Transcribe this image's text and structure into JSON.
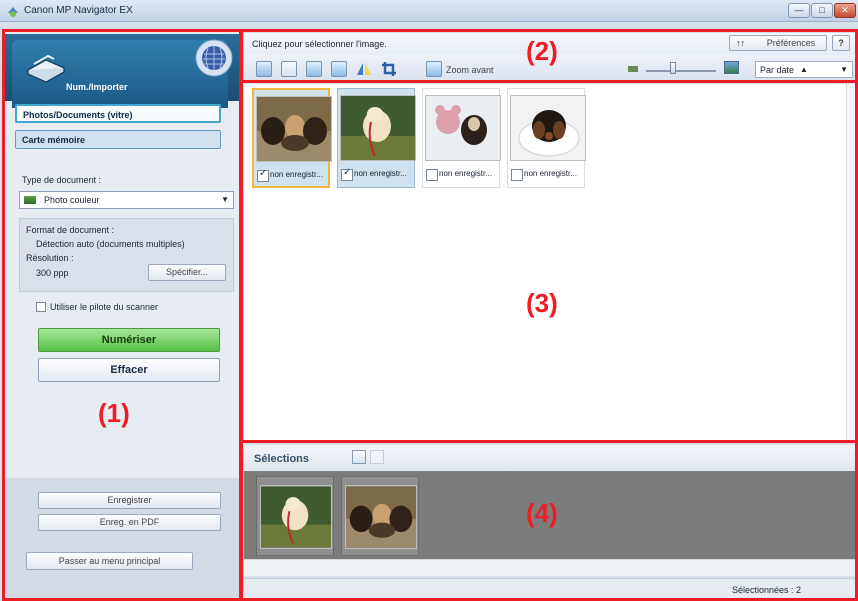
{
  "window": {
    "title": "Canon MP Navigator EX",
    "controls": {
      "minimize": "—",
      "maximize": "□",
      "close": "✕"
    }
  },
  "sidebar": {
    "hero_label": "Num./Importer",
    "modes": [
      "Photos/Documents (vitre)",
      "Carte mémoire"
    ],
    "doc_type_label": "Type de document :",
    "doc_type_value": "Photo couleur",
    "format_label": "Format de document :",
    "format_value": "Détection auto (documents multiples)",
    "resolution_label": "Résolution :",
    "resolution_value": "300 ppp",
    "specify_button": "Spécifier...",
    "driver_checkbox_label": "Utiliser le pilote du scanner",
    "scan_button": "Numériser",
    "clear_button": "Effacer",
    "save_button": "Enregistrer",
    "save_pdf_button": "Enreg. en PDF",
    "main_menu_button": "Passer au menu principal"
  },
  "toolbar": {
    "hint": "Cliquez pour sélectionner l'image.",
    "preferences_icon": "↑↑",
    "preferences": "Préférences",
    "help": "?",
    "zoom_in": "Zoom avant",
    "sort": "Par date",
    "sort_arrow": "▲",
    "dropdown_arrow": "▼"
  },
  "thumbnails": [
    {
      "caption": "non enregistr...",
      "checked": true,
      "selected": true,
      "focused": true,
      "scene": "dogs-group"
    },
    {
      "caption": "non enregistr...",
      "checked": true,
      "selected": true,
      "focused": false,
      "scene": "dog-leash"
    },
    {
      "caption": "non enregistr...",
      "checked": false,
      "selected": false,
      "focused": false,
      "scene": "bear-dog"
    },
    {
      "caption": "non enregistr...",
      "checked": false,
      "selected": false,
      "focused": false,
      "scene": "dog-plate"
    }
  ],
  "selections": {
    "title": "Sélections",
    "items": [
      {
        "scene": "dog-leash"
      },
      {
        "scene": "dogs-group"
      }
    ]
  },
  "status": {
    "selected": "Sélectionnées : 2"
  },
  "annotations": [
    "(1)",
    "(2)",
    "(3)",
    "(4)"
  ]
}
